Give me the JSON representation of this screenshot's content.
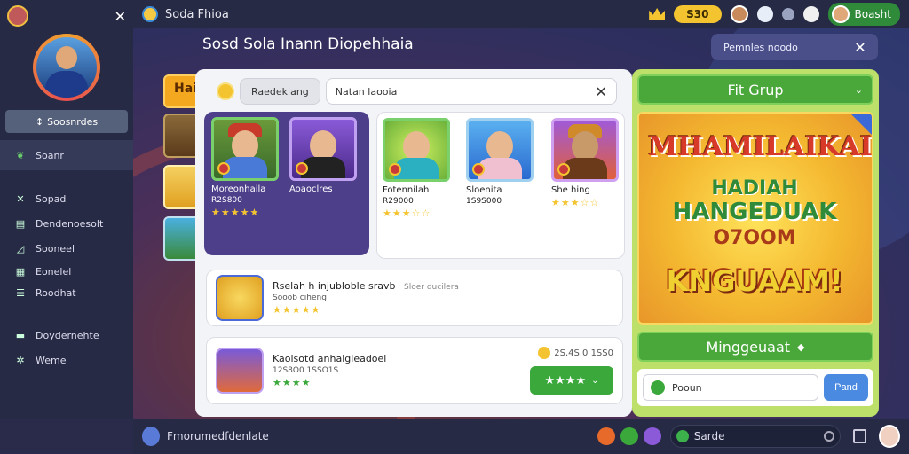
{
  "topbar": {
    "title": "Soda Fhioa",
    "coins": "S30",
    "badge_label": "Boasht"
  },
  "sidebar": {
    "profile_name": "Soosnrdes",
    "items": [
      {
        "label": "Soanr",
        "icon": "leaf-icon",
        "active": true
      },
      {
        "label": "Sopad",
        "icon": "tools-icon"
      },
      {
        "label": "Dendenoesolt",
        "icon": "list-icon"
      },
      {
        "label": "Sooneel",
        "icon": "chart-icon"
      },
      {
        "label": "Eonelel",
        "icon": "grid-icon"
      },
      {
        "label": "Roodhat",
        "icon": "document-icon"
      },
      {
        "label": "Doydernehte",
        "icon": "card-icon"
      },
      {
        "label": "Weme",
        "icon": "gear-icon"
      }
    ]
  },
  "stage": {
    "title": "Sosd Sola Inann Diopehhaia",
    "search_label": "Pemnles noodo"
  },
  "peek_tab_label": "Hai",
  "main": {
    "filter_chip": "Raedeklang",
    "search_value": "Natan laooia",
    "cards": [
      {
        "title": "Moreonhaila",
        "sub": "R2S800",
        "stars": "★★★★★"
      },
      {
        "title": "Aoaoclres",
        "sub": "",
        "stars": ""
      },
      {
        "title": "Fotennilah",
        "sub": "R29000",
        "stars": "★★★☆☆"
      },
      {
        "title": "Sloenita",
        "sub": "1S9S000",
        "stars": ""
      },
      {
        "title": "She hing",
        "sub": "",
        "stars": "★★★☆☆"
      }
    ],
    "list": [
      {
        "title": "Rselah h injubloble sravb",
        "extra": "Sloer ducilera",
        "sub": "Sooob ciheng",
        "stars": "★★★★★"
      },
      {
        "title": "Kaolsotd anhaigleadoel",
        "extra": "",
        "sub": "12S8O0 1SSO1S",
        "stars": "★★★★",
        "price": "2S.4S.0 1SS0",
        "button": "★★★★"
      }
    ]
  },
  "right_panel": {
    "dropdown": "Fit Grup",
    "promo": {
      "line1": "MHAMILAIKAI",
      "line2": "HADIAH",
      "line3": "HANGEDUAK",
      "line4": "O7OOM",
      "line5": "KNGUAAM!"
    },
    "cta": "Minggeuaat",
    "chat_placeholder": "Pooun",
    "send": "Pand"
  },
  "bottombar": {
    "user_text": "Fmorumedfdenlate",
    "chat_text": "Sarde"
  },
  "colors": {
    "accent_green": "#3aa83a",
    "coin_gold": "#f4c430",
    "panel_bg": "#f3f4f8",
    "dark_bg": "#262a45"
  }
}
